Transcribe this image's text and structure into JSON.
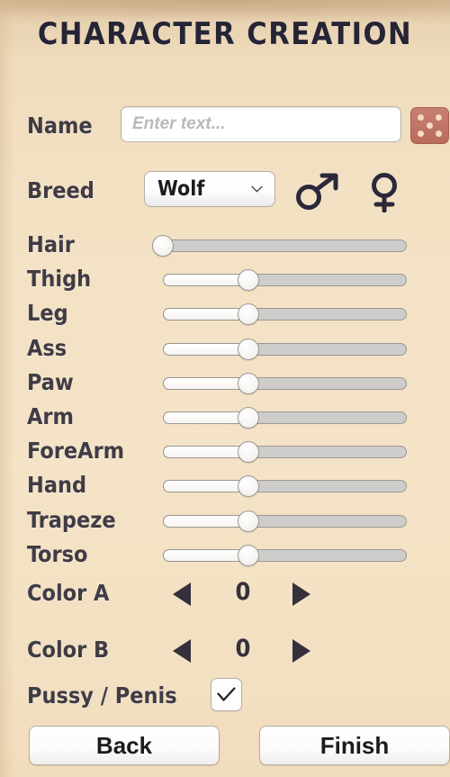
{
  "header": {
    "title": "Character Creation"
  },
  "name": {
    "label": "Name",
    "value": "",
    "placeholder": "Enter text...",
    "randomize_icon": "dice-icon"
  },
  "breed": {
    "label": "Breed",
    "selected": "Wolf",
    "options": [
      "Wolf"
    ],
    "chevron_icon": "chevron-down-icon",
    "male_icon": "male-gender-icon",
    "female_icon": "female-gender-icon"
  },
  "sliders": [
    {
      "label": "Hair",
      "percent": 0
    },
    {
      "label": "Thigh",
      "percent": 35
    },
    {
      "label": "Leg",
      "percent": 35
    },
    {
      "label": "Ass",
      "percent": 35
    },
    {
      "label": "Paw",
      "percent": 35
    },
    {
      "label": "Arm",
      "percent": 35
    },
    {
      "label": "ForeArm",
      "percent": 35
    },
    {
      "label": "Hand",
      "percent": 35
    },
    {
      "label": "Trapeze",
      "percent": 35
    },
    {
      "label": "Torso",
      "percent": 35
    }
  ],
  "colors": [
    {
      "label": "Color A",
      "value": "0",
      "prev_icon": "triangle-left-icon",
      "next_icon": "triangle-right-icon"
    },
    {
      "label": "Color B",
      "value": "0",
      "prev_icon": "triangle-left-icon",
      "next_icon": "triangle-right-icon"
    }
  ],
  "genitals": {
    "label": "Pussy / Penis",
    "checked": true,
    "check_icon": "check-icon"
  },
  "footer": {
    "back_label": "Back",
    "finish_label": "Finish"
  },
  "theme": {
    "background_top": "#d8bd9a",
    "background_main": "#f3e1c4",
    "text_dark": "#403c46",
    "title_color": "#262536",
    "dice_button": "#c1705f",
    "slider_track": "#cfcdcb",
    "accent_dark": "#36303c"
  }
}
